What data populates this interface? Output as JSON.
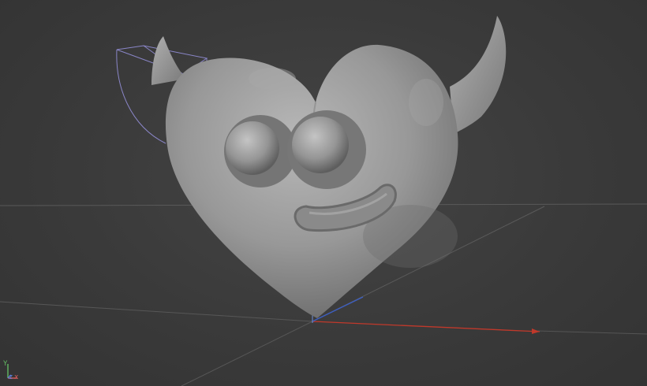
{
  "viewport": {
    "background_color": "#3b3b3b",
    "model_color": "#9a9a9a",
    "grid_line_color": "#555555",
    "x_axis_color": "#c0392b",
    "selection_cage_color": "#8a86c8"
  },
  "axis_gizmo": {
    "y_label": "Y",
    "z_label": "z",
    "x_label": "x",
    "y_color": "#62b862",
    "z_color": "#5b7fd6",
    "x_color": "#d45c5c"
  }
}
